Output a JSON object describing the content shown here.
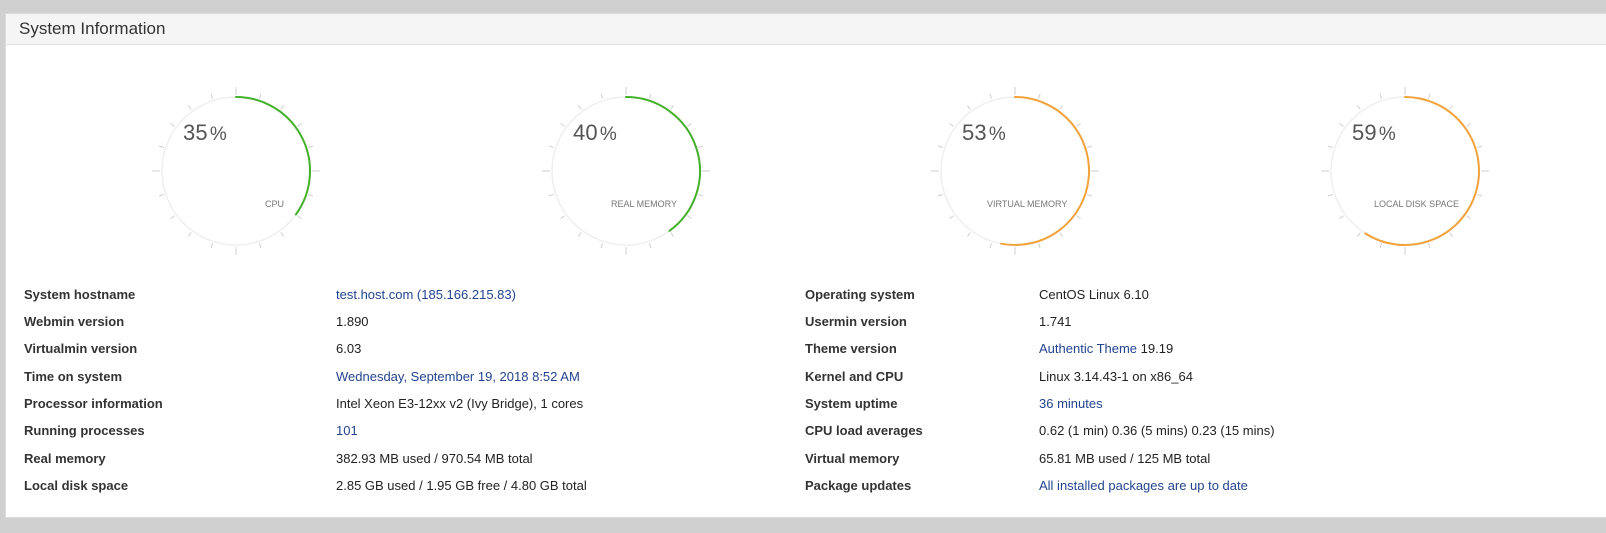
{
  "panel": {
    "title": "System Information"
  },
  "gauges": [
    {
      "value": "35",
      "unit": "%",
      "label": "CPU",
      "fraction": 0.35,
      "color": "#43b02a"
    },
    {
      "value": "40",
      "unit": "%",
      "label": "REAL MEMORY",
      "fraction": 0.4,
      "color": "#43b02a"
    },
    {
      "value": "53",
      "unit": "%",
      "label": "VIRTUAL MEMORY",
      "fraction": 0.53,
      "color": "#f2a23b"
    },
    {
      "value": "59",
      "unit": "%",
      "label": "LOCAL DISK SPACE",
      "fraction": 0.59,
      "color": "#f2a23b"
    }
  ],
  "left_info": [
    {
      "label": "System hostname",
      "value": "test.host.com (185.166.215.83)",
      "is_link": true
    },
    {
      "label": "Webmin version",
      "value": "1.890",
      "is_link": false
    },
    {
      "label": "Virtualmin version",
      "value": "6.03",
      "is_link": false
    },
    {
      "label": "Time on system",
      "value": "Wednesday, September 19, 2018 8:52 AM",
      "is_link": true
    },
    {
      "label": "Processor information",
      "value": "Intel Xeon E3-12xx v2 (Ivy Bridge), 1 cores",
      "is_link": false
    },
    {
      "label": "Running processes",
      "value": "101",
      "is_link": true
    },
    {
      "label": "Real memory",
      "value": "382.93 MB used / 970.54 MB total",
      "is_link": false
    },
    {
      "label": "Local disk space",
      "value": "2.85 GB used / 1.95 GB free / 4.80 GB total",
      "is_link": false
    }
  ],
  "right_info": [
    {
      "label": "Operating system",
      "value": "CentOS Linux 6.10",
      "is_link": false
    },
    {
      "label": "Usermin version",
      "value": "1.741",
      "is_link": false
    },
    {
      "label": "Theme version",
      "value": "Authentic Theme",
      "value_suffix": " 19.19",
      "is_link": true
    },
    {
      "label": "Kernel and CPU",
      "value": "Linux 3.14.43-1 on x86_64",
      "is_link": false
    },
    {
      "label": "System uptime",
      "value": "36 minutes",
      "is_link": true
    },
    {
      "label": "CPU load averages",
      "value": "0.62 (1 min) 0.36 (5 mins) 0.23 (15 mins)",
      "is_link": false
    },
    {
      "label": "Virtual memory",
      "value": "65.81 MB used / 125 MB total",
      "is_link": false
    },
    {
      "label": "Package updates",
      "value": "All installed packages are up to date",
      "is_link": true
    }
  ]
}
